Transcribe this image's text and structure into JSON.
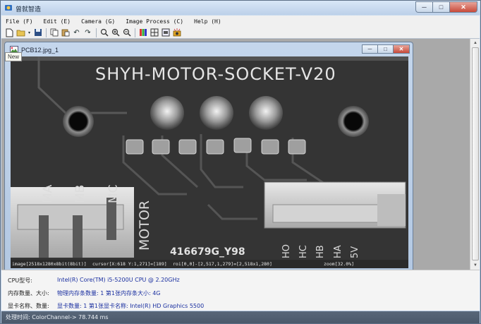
{
  "window": {
    "title": "曾就智造",
    "minimize": "─",
    "maximize": "□",
    "close": "✕"
  },
  "menu": [
    "File (F)",
    "Edit (E)",
    "Camera (G)",
    "Image Process (C)",
    "Help (H)"
  ],
  "toolbar": {
    "icons": [
      "new-icon",
      "open-icon",
      "save-icon",
      "copy-icon",
      "paste-icon",
      "undo-icon",
      "redo-icon",
      "zoom-fit-icon",
      "zoom-in-icon",
      "zoom-out-icon",
      "color-channel-icon",
      "grid-icon",
      "settings-icon",
      "camera-icon"
    ],
    "tooltip": "New"
  },
  "child_window": {
    "title": "PCB12.jpg_1",
    "minimize": "─",
    "maximize": "□",
    "close": "✕"
  },
  "image": {
    "silkscreen_title": "SHYH-MOTOR-SOCKET-V20",
    "silkscreen_code": "416679G_Y98",
    "labels_left": [
      "MA",
      "MB",
      "MC"
    ],
    "label_motor": "MOTOR",
    "labels_right": [
      "HO",
      "HC",
      "HB",
      "HA",
      "5V"
    ]
  },
  "image_status": {
    "info": "image[2518x1280x8bit(8bit)]",
    "cursor": "cursor[X:618 Y:1,271]=[189]",
    "roi": "roi[0,0]-[2,517,1,279]=[2,518x1,280]",
    "zoom": "zoom[32.0%]"
  },
  "info_panel": {
    "rows": [
      {
        "label": "CPU型号:",
        "value": "Intel(R) Core(TM) i5-5200U CPU @ 2.20GHz"
      },
      {
        "label": "内存数量、大小:",
        "value": "物理内存条数量: 1   第1张内存条大小: 4G"
      },
      {
        "label": "显卡名称、数量:",
        "value": "显卡数量: 1   第1张显卡名称: Intel(R) HD Graphics 5500"
      }
    ]
  },
  "statusbar": {
    "text": "处理时间: ColorChannel-> 78.744 ms"
  }
}
